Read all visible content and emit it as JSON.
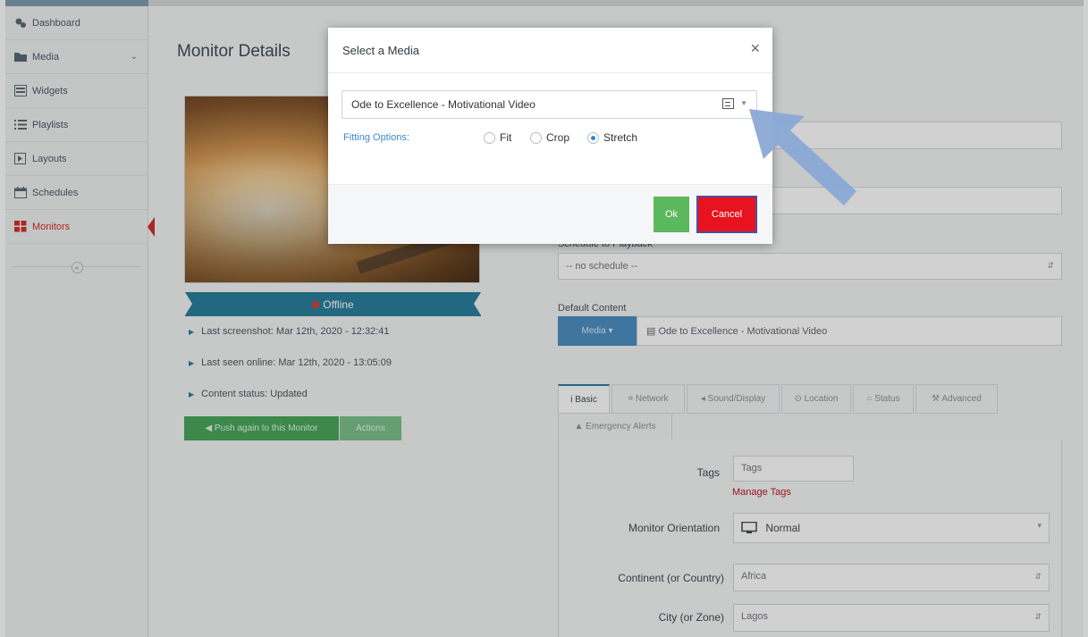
{
  "sidebar": {
    "items": [
      {
        "label": "Dashboard",
        "icon": "dashboard-icon"
      },
      {
        "label": "Media",
        "icon": "folder-icon",
        "chevron": "⌄"
      },
      {
        "label": "Widgets",
        "icon": "widgets-icon"
      },
      {
        "label": "Playlists",
        "icon": "playlist-icon"
      },
      {
        "label": "Layouts",
        "icon": "layout-icon"
      },
      {
        "label": "Schedules",
        "icon": "calendar-icon"
      },
      {
        "label": "Monitors",
        "icon": "monitors-icon"
      }
    ],
    "collapse_glyph": "«",
    "active_color": "#d0312a"
  },
  "main": {
    "title": "Monitor Details",
    "status": "Offline",
    "last_screenshot": "Last screenshot: Mar 12th, 2020 - 12:32:41",
    "last_seen": "Last seen online: Mar 12th, 2020 - 13:05:09",
    "content_status": "Content status: Updated",
    "push_button": "◀ Push again to this Monitor",
    "actions_button": "Actions"
  },
  "form": {
    "schedule_label": "Schedule to Playback",
    "schedule_value": "-- no schedule --",
    "default_content_label": "Default Content",
    "media_button": "Media ▾",
    "default_content_value": "▤ Ode to Excellence - Motivational Video",
    "tabs": [
      "i Basic",
      "⌗ Network",
      "◂ Sound/Display",
      "⊙ Location",
      "○ Status",
      "⚒ Advanced",
      "▲ Emergency Alerts"
    ],
    "tags_label": "Tags",
    "tags_placeholder": "Tags",
    "manage_tags": "Manage Tags",
    "orientation_label": "Monitor Orientation",
    "orientation_value": "Normal",
    "continent_label": "Continent (or Country)",
    "continent_value": "Africa",
    "city_label": "City (or Zone)",
    "city_value": "Lagos"
  },
  "modal": {
    "title": "Select a Media",
    "close": "×",
    "selected_media": "Ode to Excellence - Motivational Video",
    "fitting_label": "Fitting Options:",
    "options": [
      {
        "label": "Fit",
        "checked": false
      },
      {
        "label": "Crop",
        "checked": false
      },
      {
        "label": "Stretch",
        "checked": true
      }
    ],
    "ok": "Ok",
    "cancel": "Cancel",
    "ok_color": "#5cb85c",
    "cancel_color": "#e8131f"
  },
  "annotation": {
    "arrow_color": "#8aa9d6"
  }
}
